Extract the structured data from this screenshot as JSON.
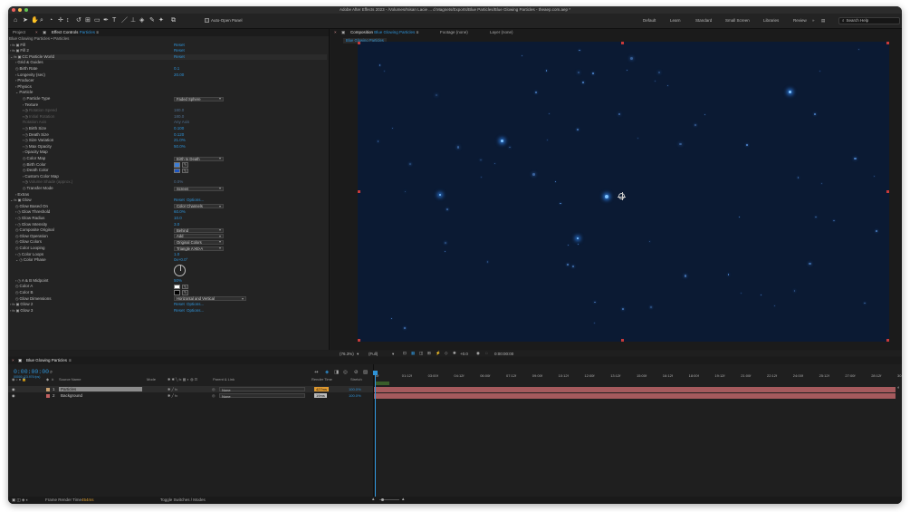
{
  "window": {
    "title": "Adobe After Effects 2023 - /Volumes/Nisan Lacie ... d Magnets/Exports/Blue Particles/Blue Glowing Particles - theaep.com.aep *",
    "traffic_colors": [
      "#ee5f5b",
      "#f5be4f",
      "#62c554"
    ]
  },
  "toolbar": {
    "auto_open_panel": "Auto-Open Panel",
    "workspaces": [
      "Default",
      "Learn",
      "Standard",
      "Small Screen",
      "Libraries",
      "Review"
    ],
    "search_placeholder": "Search Help"
  },
  "effect_controls": {
    "tab_project": "Project",
    "tab_label": "Effect Controls",
    "tab_layer": "Particles",
    "header": "Blue Glowing Particles • Particles",
    "rows": [
      {
        "indent": 2,
        "arrow": "›",
        "fx": true,
        "label": "Fill",
        "value": "Reset"
      },
      {
        "indent": 2,
        "arrow": "›",
        "fx": true,
        "label": "Fill 2",
        "value": "Reset"
      },
      {
        "indent": 2,
        "arrow": "⌄",
        "fx": true,
        "label": "CC Particle World",
        "value": "Reset",
        "sel": true
      },
      {
        "indent": 8,
        "arrow": "›",
        "label": "Grid & Guides"
      },
      {
        "indent": 8,
        "arrow": "",
        "sw": true,
        "label": "Birth Rate",
        "value": "0.1"
      },
      {
        "indent": 8,
        "arrow": "›",
        "label": "Longevity (sec)",
        "value": "20.00"
      },
      {
        "indent": 8,
        "arrow": "›",
        "label": "Producer"
      },
      {
        "indent": 8,
        "arrow": "›",
        "label": "Physics"
      },
      {
        "indent": 8,
        "arrow": "⌄",
        "label": "Particle"
      },
      {
        "indent": 16,
        "arrow": "",
        "sw": true,
        "label": "Particle Type",
        "dropdown": "Faded Sphere"
      },
      {
        "indent": 16,
        "arrow": "›",
        "label": "Texture"
      },
      {
        "indent": 16,
        "arrow": "›",
        "sw": true,
        "label": "Rotation Speed",
        "value": "180.0",
        "dim": true
      },
      {
        "indent": 16,
        "arrow": "›",
        "sw": true,
        "label": "Initial Rotation",
        "value": "180.0",
        "dim": true
      },
      {
        "indent": 16,
        "arrow": "",
        "label": "Rotation Axis",
        "value": "Any Axis",
        "dim": true
      },
      {
        "indent": 16,
        "arrow": "›",
        "sw": true,
        "label": "Birth Size",
        "value": "0.100"
      },
      {
        "indent": 16,
        "arrow": "›",
        "sw": true,
        "label": "Death Size",
        "value": "0.120"
      },
      {
        "indent": 16,
        "arrow": "›",
        "sw": true,
        "label": "Size Variation",
        "value": "21.0%"
      },
      {
        "indent": 16,
        "arrow": "›",
        "sw": true,
        "label": "Max Opacity",
        "value": "50.0%"
      },
      {
        "indent": 16,
        "arrow": "›",
        "label": "Opacity Map"
      },
      {
        "indent": 16,
        "arrow": "",
        "sw": true,
        "label": "Color Map",
        "dropdown": "Birth to Death"
      },
      {
        "indent": 16,
        "arrow": "",
        "sw": true,
        "label": "Birth Color",
        "swatch": "#3d7ed6"
      },
      {
        "indent": 16,
        "arrow": "",
        "sw": true,
        "label": "Death Color",
        "swatch": "#1e56c0"
      },
      {
        "indent": 16,
        "arrow": "›",
        "label": "Custom Color Map"
      },
      {
        "indent": 16,
        "arrow": "›",
        "sw": true,
        "label": "Volume Shade (approx.)",
        "value": "0.0%",
        "dim": true
      },
      {
        "indent": 16,
        "arrow": "",
        "sw": true,
        "label": "Transfer Mode",
        "dropdown": "Screen"
      },
      {
        "indent": 8,
        "arrow": "›",
        "label": "Extras"
      },
      {
        "indent": 2,
        "arrow": "⌄",
        "fx": true,
        "label": "Glow",
        "value": "Reset",
        "value2": "Options..."
      },
      {
        "indent": 8,
        "arrow": "",
        "sw": true,
        "label": "Glow Based On",
        "dropdown": "Color Channels"
      },
      {
        "indent": 8,
        "arrow": "›",
        "sw": true,
        "label": "Glow Threshold",
        "value": "60.0%"
      },
      {
        "indent": 8,
        "arrow": "›",
        "sw": true,
        "label": "Glow Radius",
        "value": "10.0"
      },
      {
        "indent": 8,
        "arrow": "›",
        "sw": true,
        "label": "Glow Intensity",
        "value": "3.0"
      },
      {
        "indent": 8,
        "arrow": "",
        "sw": true,
        "label": "Composite Original",
        "dropdown": "Behind"
      },
      {
        "indent": 8,
        "arrow": "",
        "sw": true,
        "label": "Glow Operation",
        "dropdown": "Add"
      },
      {
        "indent": 8,
        "arrow": "",
        "sw": true,
        "label": "Glow Colors",
        "dropdown": "Original Colors"
      },
      {
        "indent": 8,
        "arrow": "",
        "sw": true,
        "label": "Color Looping",
        "dropdown": "Triangle A>B>A"
      },
      {
        "indent": 8,
        "arrow": "›",
        "sw": true,
        "label": "Color Loops",
        "value": "1.0"
      },
      {
        "indent": 8,
        "arrow": "⌄",
        "sw": true,
        "label": "Color Phase",
        "value": "0x+0.0°"
      },
      {
        "indent": 8,
        "arrow": "",
        "label": "",
        "dial": true
      },
      {
        "indent": 8,
        "arrow": "›",
        "sw": true,
        "label": "A & B Midpoint",
        "value": "50%"
      },
      {
        "indent": 8,
        "arrow": "",
        "sw": true,
        "label": "Color A",
        "swatch": "#ffffff"
      },
      {
        "indent": 8,
        "arrow": "",
        "sw": true,
        "label": "Color B",
        "swatch": "#000000"
      },
      {
        "indent": 8,
        "arrow": "",
        "sw": true,
        "label": "Glow Dimensions",
        "dropdown": "Horizontal and Vertical"
      },
      {
        "indent": 2,
        "arrow": "›",
        "fx": true,
        "label": "Glow 2",
        "value": "Reset",
        "value2": "Options..."
      },
      {
        "indent": 2,
        "arrow": "›",
        "fx": true,
        "label": "Glow 3",
        "value": "Reset",
        "value2": "Options..."
      }
    ]
  },
  "composition": {
    "tab_label": "Composition",
    "tab_comp": "Blue Glowing Particles",
    "tab_footage": "Footage (none)",
    "tab_layer": "Layer (none)",
    "breadcrumb": "Blue Glowing Particles",
    "bg_color": "#0b1a33",
    "zoom": "(76.3%)",
    "quality": "(Full)",
    "exposure": "+0.0",
    "timecode": "0:00:00:00"
  },
  "timeline": {
    "tab_label": "Blue Glowing Particles",
    "timecode": "0:00:00:00",
    "timecode_sub": "00000 (23.976 fps)",
    "col_source": "Source Name",
    "col_mode": "Mode",
    "col_parent": "Parent & Link",
    "col_render": "Render Time",
    "col_stretch": "Stretch",
    "layers": [
      {
        "num": "1",
        "name": "Particles",
        "parent": "None",
        "render": "427ms",
        "stretch": "100.0%",
        "color": "#c8a070",
        "selected": true
      },
      {
        "num": "2",
        "name": "Background",
        "parent": "None",
        "render": "19ms",
        "stretch": "100.0%",
        "color": "#c06060",
        "selected": false
      }
    ],
    "ruler_ticks": [
      "0f",
      "01:12f",
      "03:00f",
      "04:12f",
      "06:00f",
      "07:12f",
      "09:00f",
      "10:12f",
      "12:00f",
      "13:12f",
      "15:00f",
      "16:12f",
      "18:00f",
      "19:12f",
      "21:00f",
      "22:12f",
      "24:00f",
      "25:12f",
      "27:00f",
      "28:12f",
      "30:00f"
    ],
    "frame_render_label": "Frame Render Time",
    "frame_render_value": "454ms",
    "toggle_label": "Toggle Switches / Modes"
  }
}
